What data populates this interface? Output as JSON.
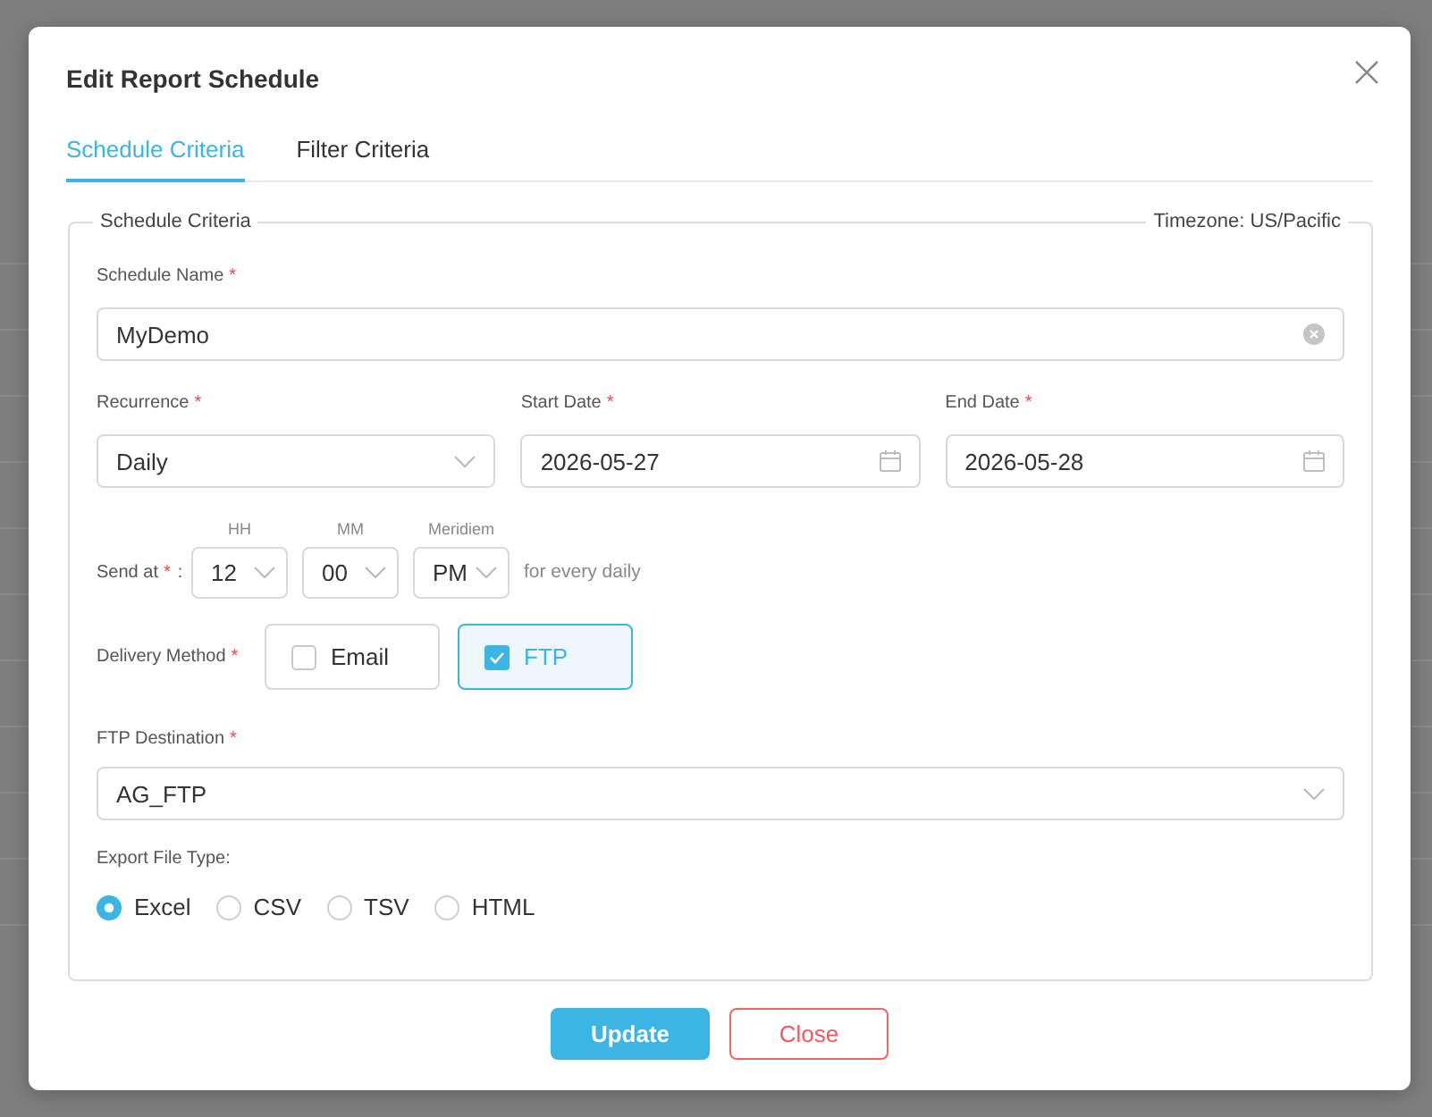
{
  "dialog": {
    "title": "Edit Report Schedule"
  },
  "tabs": [
    {
      "label": "Schedule Criteria",
      "selected": true
    },
    {
      "label": "Filter Criteria",
      "selected": false
    }
  ],
  "section": {
    "legend": "Schedule Criteria",
    "timezone": "Timezone: US/Pacific"
  },
  "schedule_name": {
    "label": "Schedule Name",
    "required_mark": "*",
    "value": "MyDemo"
  },
  "recurrence": {
    "label": "Recurrence",
    "required_mark": "*",
    "value": "Daily"
  },
  "start_date": {
    "label": "Start Date",
    "required_mark": "*",
    "value": "2026-05-27"
  },
  "end_date": {
    "label": "End Date",
    "required_mark": "*",
    "value": "2026-05-28"
  },
  "send_at": {
    "label": "Send at",
    "required_mark": "*",
    "label_suffix": ":",
    "fields": [
      {
        "caption": "HH",
        "value": "12"
      },
      {
        "caption": "MM",
        "value": "00"
      },
      {
        "caption": "Meridiem",
        "value": "PM"
      }
    ],
    "note": "for every daily"
  },
  "delivery_method": {
    "label": "Delivery Method",
    "required_mark": "*",
    "options": [
      {
        "label": "Email",
        "checked": false
      },
      {
        "label": "FTP",
        "checked": true
      }
    ]
  },
  "ftp_destination": {
    "label": "FTP Destination",
    "required_mark": "*",
    "value": "AG_FTP"
  },
  "export_file_type": {
    "label": "Export File Type:",
    "options": [
      {
        "label": "Excel",
        "selected": true
      },
      {
        "label": "CSV",
        "selected": false
      },
      {
        "label": "TSV",
        "selected": false
      },
      {
        "label": "HTML",
        "selected": false
      }
    ]
  },
  "buttons": [
    {
      "label": "Update",
      "kind": "primary"
    },
    {
      "label": "Close",
      "kind": "danger"
    }
  ]
}
